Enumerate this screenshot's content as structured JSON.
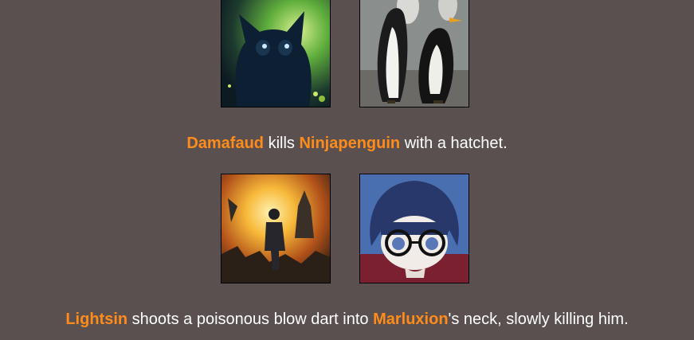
{
  "events": [
    {
      "avatars": [
        {
          "subject": "black kitten with green glow",
          "icon": "cat-avatar-image"
        },
        {
          "subject": "penguins",
          "icon": "penguin-avatar-image"
        }
      ],
      "actor": "Damafaud",
      "verb": " kills ",
      "target": "Ninjapenguin",
      "rest": " with a hatchet."
    },
    {
      "avatars": [
        {
          "subject": "armored soldier amid explosion",
          "icon": "soldier-avatar-image"
        },
        {
          "subject": "anime boy with glasses",
          "icon": "anime-boy-avatar-image"
        }
      ],
      "actor": "Lightsin",
      "verb": " shoots a poisonous blow dart into ",
      "target": "Marluxion",
      "rest": "'s neck, slowly killing him."
    }
  ],
  "colors": {
    "background": "#5a5050",
    "name_highlight": "#ff8c1a",
    "text": "#ffffff"
  }
}
